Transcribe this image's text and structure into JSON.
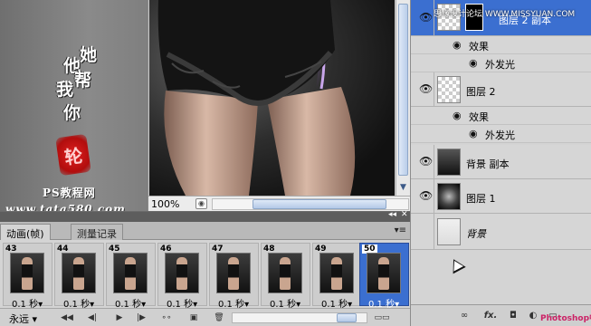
{
  "watermark_left": {
    "chars_col1": [
      "他"
    ],
    "chars_col2": [
      "她"
    ],
    "chars_row2": [
      "我",
      "帮"
    ],
    "char_row3": "你",
    "seal": "轮",
    "site_label": "PS教程网",
    "site_url": "www.tata580.com"
  },
  "document": {
    "zoom": "100%"
  },
  "layers_panel": {
    "top_watermark": "思缘设计论坛 WWW.MISSYUAN.COM",
    "layers": [
      {
        "name": "图层 2 副本",
        "selected": true,
        "effects_label": "效果",
        "effect": "外发光"
      },
      {
        "name": "图层 2",
        "selected": false,
        "effects_label": "效果",
        "effect": "外发光"
      },
      {
        "name": "背景 副本",
        "selected": false
      },
      {
        "name": "图层 1",
        "selected": false
      },
      {
        "name": "背景",
        "selected": false
      }
    ],
    "footer_icons": [
      "link-icon",
      "fx-icon",
      "mask-icon",
      "adjustment-icon",
      "folder-icon",
      "new-layer-icon",
      "trash-icon"
    ],
    "footer_fx": "fx.",
    "bottom_watermark": "Photoshop中文网"
  },
  "animation_panel": {
    "tabs": [
      {
        "label": "动画(帧)",
        "active": true
      },
      {
        "label": "测量记录",
        "active": false
      }
    ],
    "frames": [
      {
        "number": "43",
        "delay": "0.1 秒▾"
      },
      {
        "number": "44",
        "delay": "0.1 秒▾"
      },
      {
        "number": "45",
        "delay": "0.1 秒▾"
      },
      {
        "number": "46",
        "delay": "0.1 秒▾"
      },
      {
        "number": "47",
        "delay": "0.1 秒▾"
      },
      {
        "number": "48",
        "delay": "0.1 秒▾"
      },
      {
        "number": "49",
        "delay": "0.1 秒▾"
      },
      {
        "number": "50",
        "delay": "0.1 秒▾"
      }
    ],
    "loop": "永远 ▾",
    "controls": [
      "first-frame-icon",
      "prev-frame-icon",
      "play-icon",
      "next-frame-icon",
      "tween-icon",
      "new-frame-icon",
      "delete-frame-icon"
    ]
  }
}
